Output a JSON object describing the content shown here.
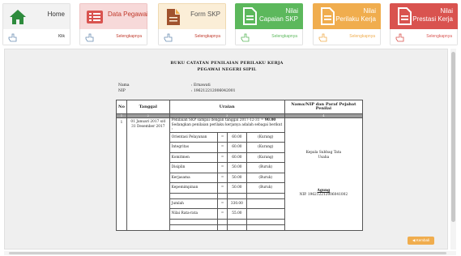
{
  "cards": [
    {
      "title": "Home",
      "more": "Klik",
      "icon": "home-icon"
    },
    {
      "title": "Data Pegawai",
      "more": "Selengkapnya",
      "icon": "list-icon"
    },
    {
      "title": "Form SKP",
      "more": "Selengkapnya",
      "icon": "document-icon"
    },
    {
      "title_line1": "Nilai",
      "title_line2": "Capaian SKP",
      "more": "Selengkapnya",
      "icon": "report-icon"
    },
    {
      "title_line1": "Nilai",
      "title_line2": "Perilaku Kerja",
      "more": "Selengkapnya",
      "icon": "report-icon"
    },
    {
      "title_line1": "Nilai",
      "title_line2": "Prestasi Kerja",
      "more": "Selengkapnya",
      "icon": "report-icon"
    }
  ],
  "document": {
    "title_line1": "BUKU CATATAN PENILAIAN PERILAKU KERJA",
    "title_line2": "PEGAWAI NEGERI SIPIL",
    "nama_label": "Nama",
    "nama_value": ": Ernawati",
    "nip_label": "NIP",
    "nip_value": ": 196212212006042001"
  },
  "table": {
    "headers": {
      "no": "No",
      "tanggal": "Tanggal",
      "uraian": "Uraian",
      "pejabat": "Nama/NIP dan Paraf Pejabat Penilai"
    },
    "index_row": [
      "1",
      "2",
      "3",
      "4"
    ],
    "row_no": "1",
    "row_tanggal": "01 Januari 2017 s/d 31 Desember 2017",
    "row_desc_prefix": "Penilaian SKP sampai dengan tanggal 2017-12-31 = ",
    "row_desc_value": "90.00",
    "row_desc_suffix": "Sedangkan penilaian perilaku kerjanya adalah sebagai berikut :",
    "items": [
      {
        "label": "Orientasi Pelayanan",
        "eq": "=",
        "value": "60.00",
        "grade": "(Kurang)"
      },
      {
        "label": "Integritas",
        "eq": "=",
        "value": "60.00",
        "grade": "(Kurang)"
      },
      {
        "label": "Komitmen",
        "eq": "=",
        "value": "60.00",
        "grade": "(Kurang)"
      },
      {
        "label": "Disiplin",
        "eq": "=",
        "value": "50.00",
        "grade": "(Buruk)"
      },
      {
        "label": "Kerjasama",
        "eq": "=",
        "value": "50.00",
        "grade": "(Buruk)"
      },
      {
        "label": "Kepemimpinan",
        "eq": "=",
        "value": "50.00",
        "grade": "(Buruk)"
      }
    ],
    "jumlah_label": "Jumlah",
    "jumlah_eq": "=",
    "jumlah_value": "330.00",
    "rata_label": "Nilai Rata-rata",
    "rata_eq": "=",
    "rata_value": "55.00",
    "pejabat_title": "Kepala Subbag Tata Usaha",
    "pejabat_name": "Agung",
    "pejabat_nip": "NIP. 196212212006041002"
  },
  "kembali_label": "Kembali"
}
